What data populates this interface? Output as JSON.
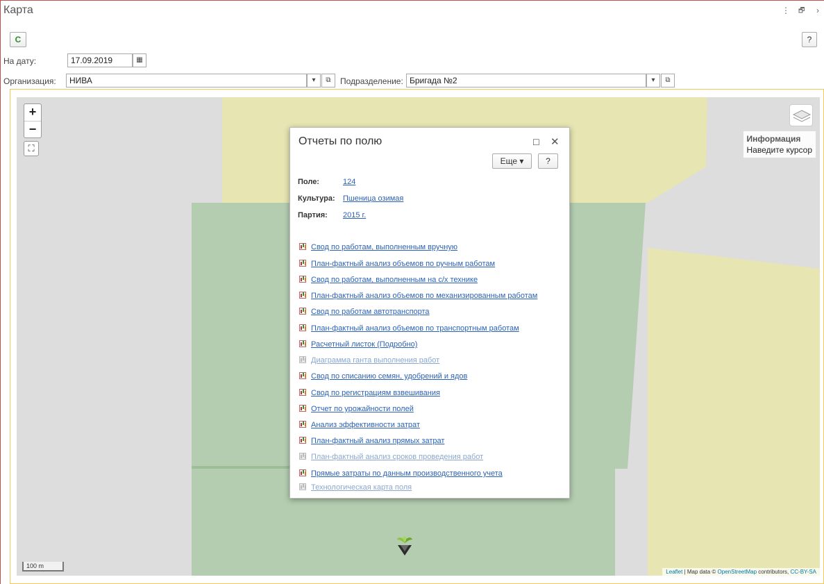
{
  "window": {
    "title": "Карта",
    "more_icon": "⋮",
    "restore_icon": "🗗",
    "close_icon": "›"
  },
  "toolbar": {
    "refresh_icon": "C",
    "help_label": "?"
  },
  "filters": {
    "date_label": "На дату:",
    "date_value": "17.09.2019",
    "org_label": "Организация:",
    "org_value": "НИВА",
    "division_label": "Подразделение:",
    "division_value": "Бригада №2"
  },
  "map": {
    "zoom_in": "+",
    "zoom_out": "−",
    "info_title": "Информация",
    "info_text": "Наведите курсор",
    "scale": "100 m",
    "attrib_leaflet": "Leaflet",
    "attrib_mid": " | Map data © ",
    "attrib_osm": "OpenStreetMap",
    "attrib_contrib": " contributors, ",
    "attrib_license": "CC-BY-SA",
    "colors": {
      "base": "#dddddd",
      "yellow": "#e7e5b1",
      "green": "#b4cdb0"
    }
  },
  "popup": {
    "title": "Отчеты по полю",
    "more_button": "Еще ▾",
    "help_button": "?",
    "field_label": "Поле:",
    "field_value": "124",
    "crop_label": "Культура:",
    "crop_value": "Пшеница озимая",
    "batch_label": "Партия:",
    "batch_value": "2015 г.",
    "reports": [
      {
        "label": "Свод по работам, выполненным вручную",
        "enabled": true
      },
      {
        "label": "План-фактный анализ объемов по ручным работам",
        "enabled": true
      },
      {
        "label": "Свод по работам, выполненным на с/х технике",
        "enabled": true
      },
      {
        "label": "План-фактный анализ объемов по механизированным работам",
        "enabled": true
      },
      {
        "label": "Свод по работам автотранспорта",
        "enabled": true
      },
      {
        "label": "План-фактный анализ объемов по транспортным работам",
        "enabled": true
      },
      {
        "label": "Расчетный листок (Подробно)",
        "enabled": true
      },
      {
        "label": "Диаграмма ганта выполнения работ",
        "enabled": false
      },
      {
        "label": "Свод по списанию семян, удобрений и ядов",
        "enabled": true
      },
      {
        "label": "Свод по регистрациям взвешивания",
        "enabled": true
      },
      {
        "label": "Отчет по урожайности полей",
        "enabled": true
      },
      {
        "label": "Анализ эффективности затрат",
        "enabled": true
      },
      {
        "label": "План-фактный анализ прямых затрат",
        "enabled": true
      },
      {
        "label": "План-фактный анализ сроков проведения работ",
        "enabled": false
      },
      {
        "label": "Прямые затраты по данным производственного учета",
        "enabled": true
      },
      {
        "label": "Технологическая карта поля",
        "enabled": false
      }
    ]
  }
}
